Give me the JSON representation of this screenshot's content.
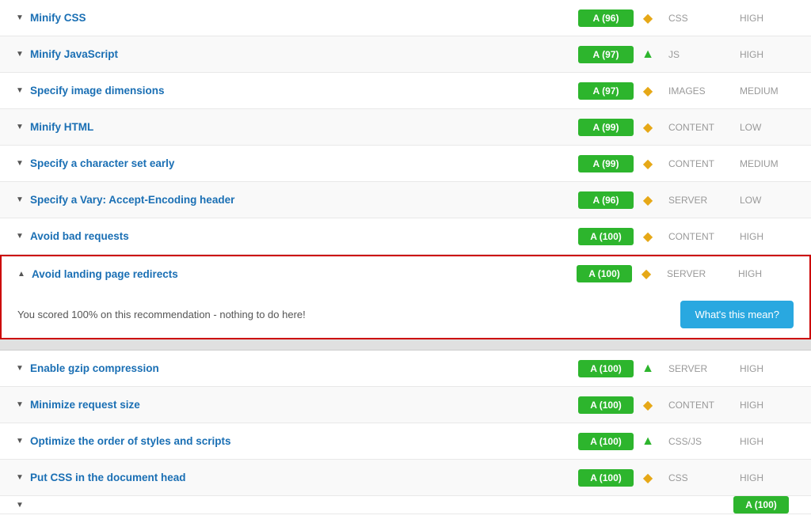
{
  "rows": [
    {
      "id": "minify-css",
      "title": "Minify CSS",
      "score": "A (96)",
      "trend": "diamond",
      "category": "CSS",
      "priority": "HIGH",
      "expanded": false
    },
    {
      "id": "minify-js",
      "title": "Minify JavaScript",
      "score": "A (97)",
      "trend": "up",
      "category": "JS",
      "priority": "HIGH",
      "expanded": false
    },
    {
      "id": "image-dimensions",
      "title": "Specify image dimensions",
      "score": "A (97)",
      "trend": "diamond",
      "category": "IMAGES",
      "priority": "MEDIUM",
      "expanded": false
    },
    {
      "id": "minify-html",
      "title": "Minify HTML",
      "score": "A (99)",
      "trend": "diamond",
      "category": "CONTENT",
      "priority": "LOW",
      "expanded": false
    },
    {
      "id": "character-set",
      "title": "Specify a character set early",
      "score": "A (99)",
      "trend": "diamond",
      "category": "CONTENT",
      "priority": "MEDIUM",
      "expanded": false
    },
    {
      "id": "vary-header",
      "title": "Specify a Vary: Accept-Encoding header",
      "score": "A (96)",
      "trend": "diamond",
      "category": "SERVER",
      "priority": "LOW",
      "expanded": false
    },
    {
      "id": "bad-requests",
      "title": "Avoid bad requests",
      "score": "A (100)",
      "trend": "diamond",
      "category": "CONTENT",
      "priority": "HIGH",
      "expanded": false
    },
    {
      "id": "landing-redirects",
      "title": "Avoid landing page redirects",
      "score": "A (100)",
      "trend": "diamond",
      "category": "SERVER",
      "priority": "HIGH",
      "expanded": true,
      "expandedText": "You scored 100% on this recommendation - nothing to do here!",
      "expandedBtn": "What's this mean?"
    }
  ],
  "rows2": [
    {
      "id": "gzip",
      "title": "Enable gzip compression",
      "score": "A (100)",
      "trend": "up",
      "category": "SERVER",
      "priority": "HIGH",
      "expanded": false
    },
    {
      "id": "request-size",
      "title": "Minimize request size",
      "score": "A (100)",
      "trend": "diamond",
      "category": "CONTENT",
      "priority": "HIGH",
      "expanded": false
    },
    {
      "id": "styles-order",
      "title": "Optimize the order of styles and scripts",
      "score": "A (100)",
      "trend": "up",
      "category": "CSS/JS",
      "priority": "HIGH",
      "expanded": false
    },
    {
      "id": "css-head",
      "title": "Put CSS in the document head",
      "score": "A (100)",
      "trend": "diamond",
      "category": "CSS",
      "priority": "HIGH",
      "expanded": false
    }
  ]
}
